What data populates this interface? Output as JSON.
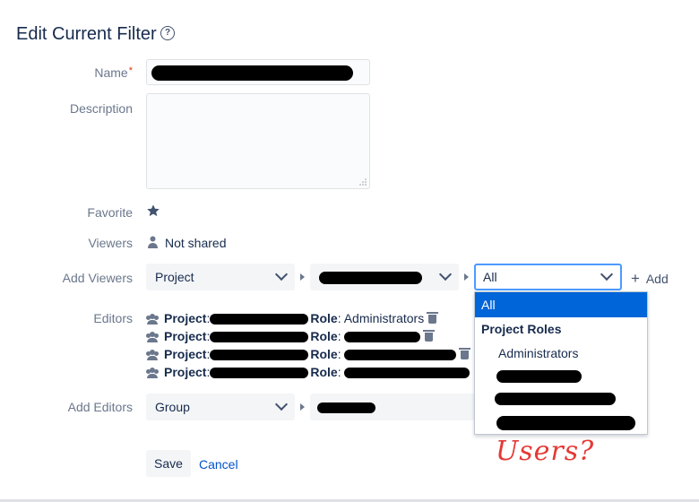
{
  "page": {
    "title": "Edit Current Filter"
  },
  "form": {
    "name_label": "Name",
    "required_marker": "*",
    "description_label": "Description",
    "favorite_label": "Favorite",
    "viewers_label": "Viewers",
    "viewers_value": "Not shared",
    "add_viewers_label": "Add Viewers",
    "add_viewers_type": "Project",
    "add_viewers_role": "All",
    "add_label": "Add",
    "editors_label": "Editors",
    "add_editors_label": "Add Editors",
    "add_editors_type": "Group"
  },
  "editors": [
    {
      "project_label": "Project",
      "role_label": "Role",
      "role_value": "Administrators"
    },
    {
      "project_label": "Project",
      "role_label": "Role",
      "role_value": ""
    },
    {
      "project_label": "Project",
      "role_label": "Role",
      "role_value": ""
    },
    {
      "project_label": "Project",
      "role_label": "Role",
      "role_value": ""
    }
  ],
  "role_dropdown": {
    "selected": "All",
    "group_heading": "Project Roles",
    "items": [
      "Administrators"
    ]
  },
  "annotation": {
    "text": "Users?",
    "color": "#e53935"
  },
  "actions": {
    "save_label": "Save",
    "cancel_label": "Cancel"
  },
  "colors": {
    "link": "#0052cc",
    "selected": "#0065d9",
    "required": "#de350b"
  }
}
